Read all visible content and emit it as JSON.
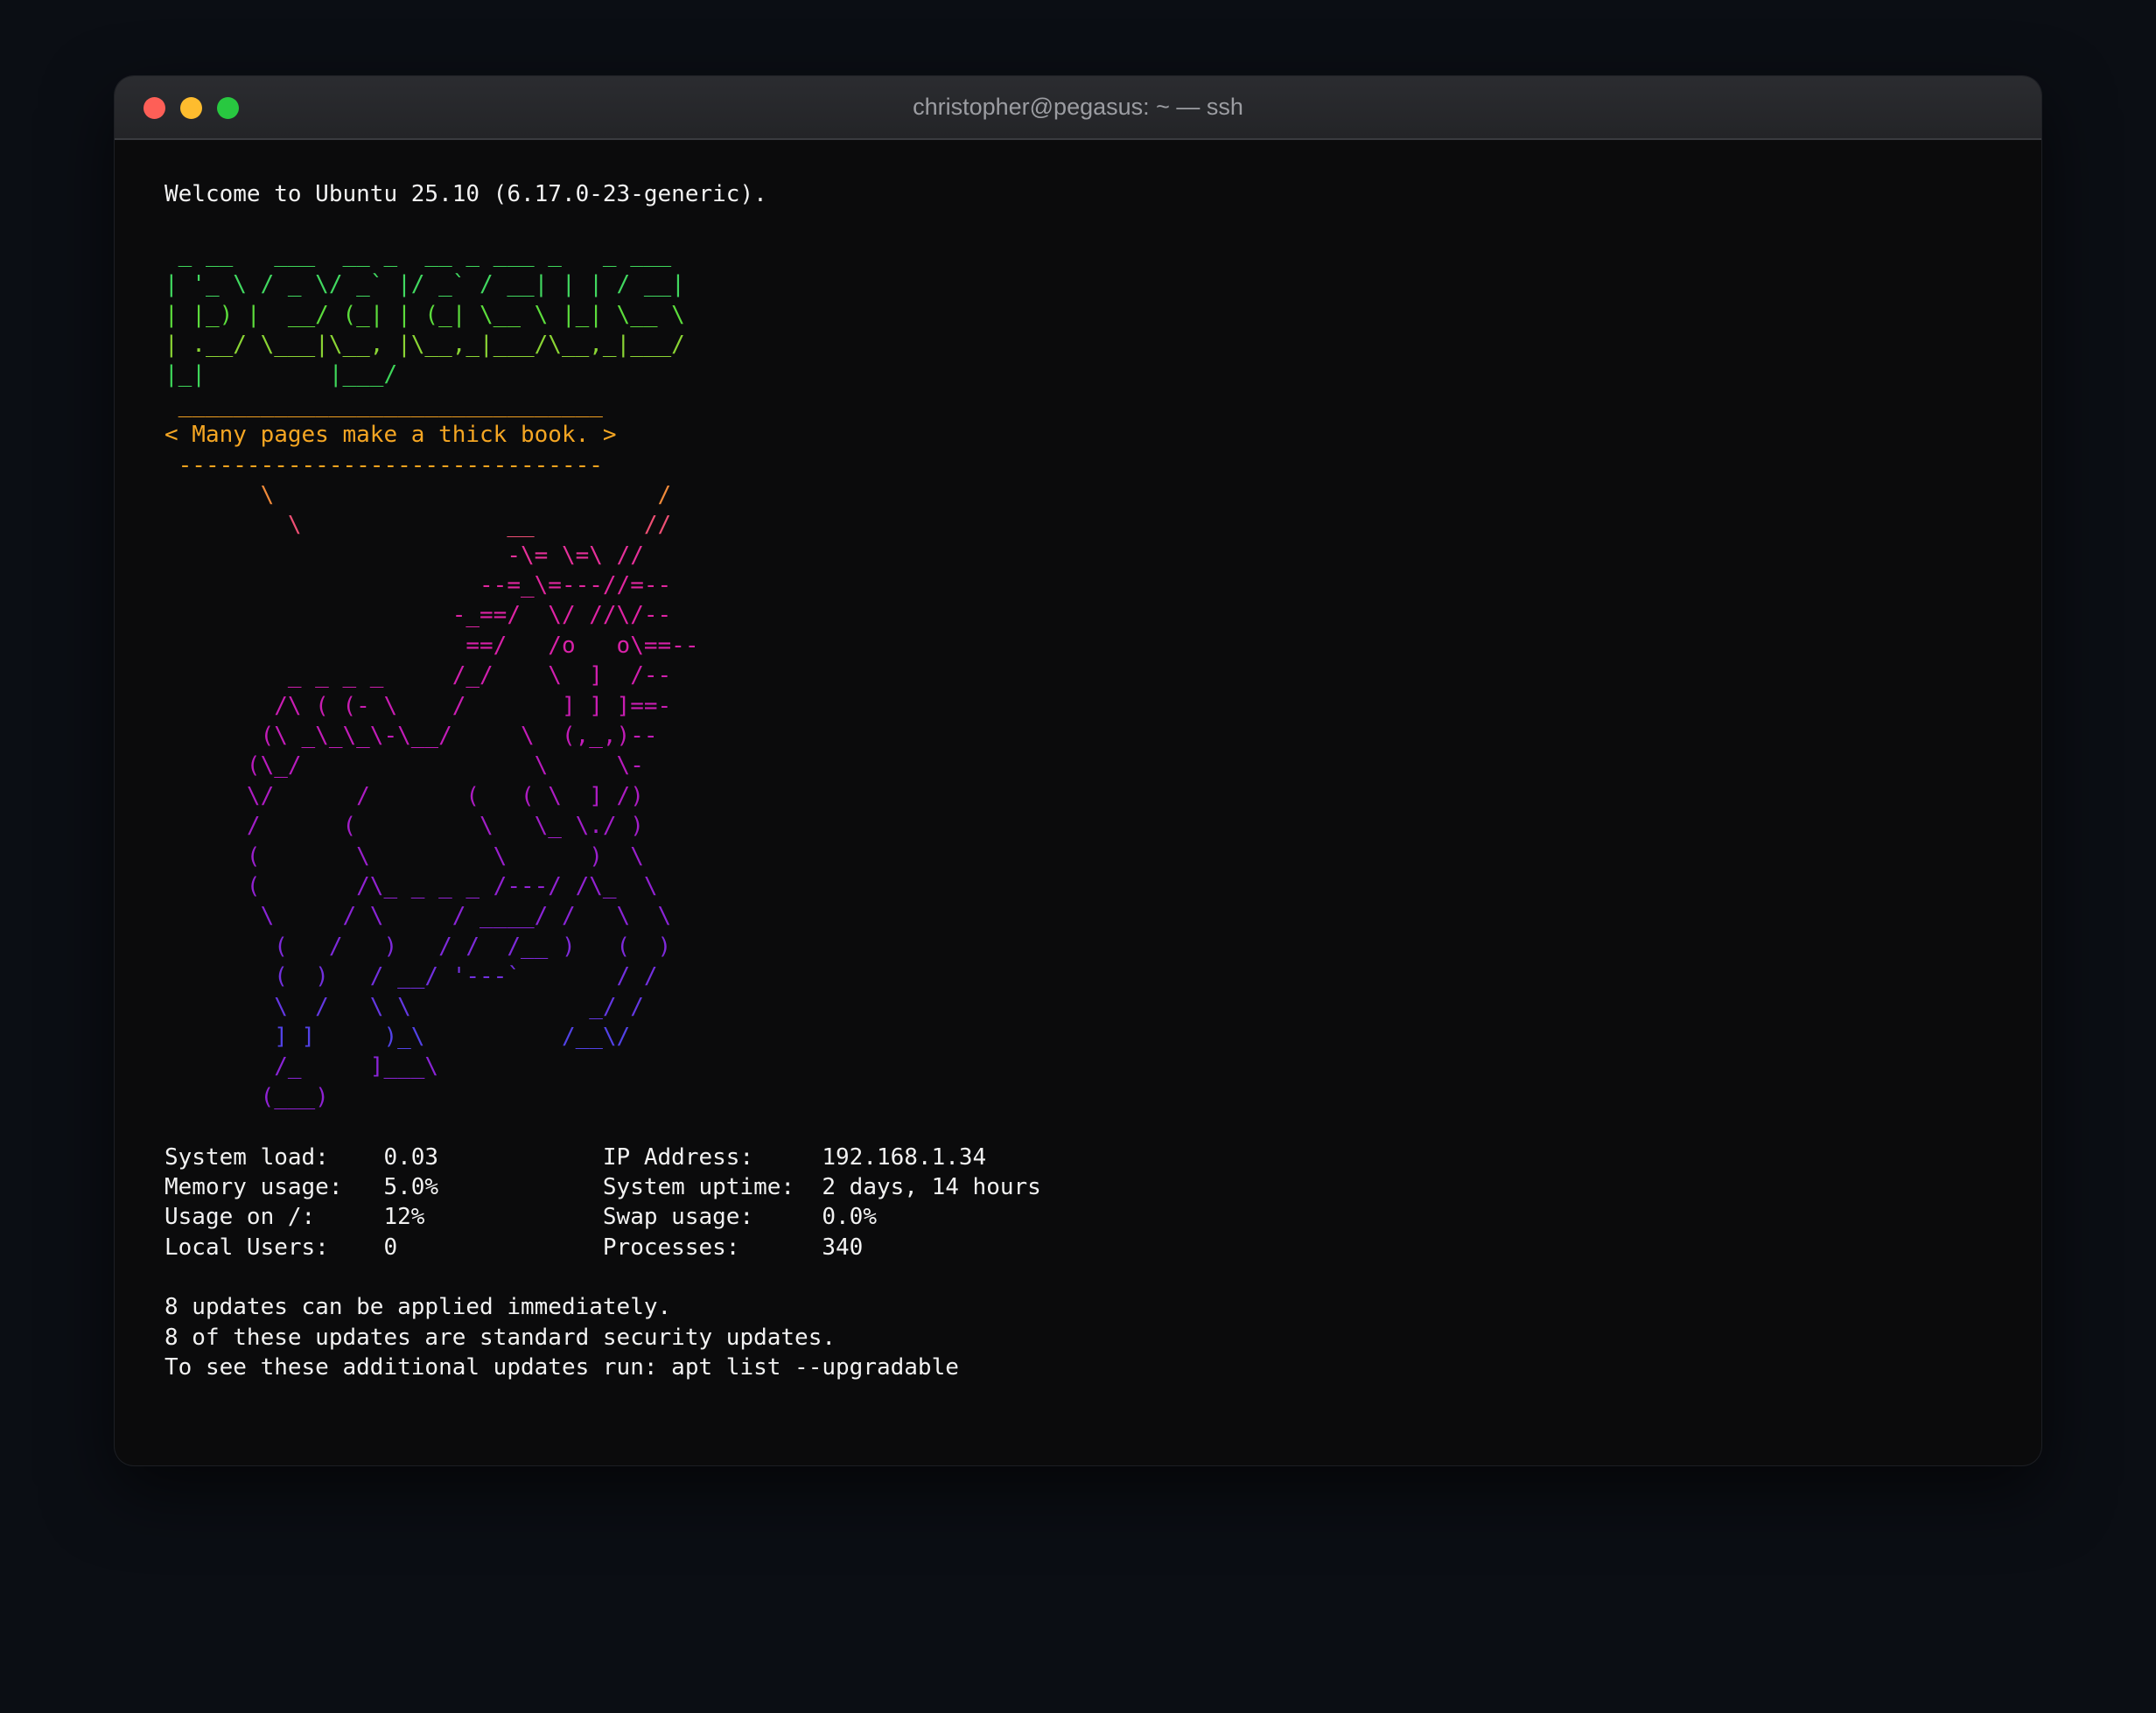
{
  "window": {
    "title": "christopher@pegasus: ~ — ssh",
    "controls": {
      "close_color": "#fe5f57",
      "minimize_color": "#febc2e",
      "zoom_color": "#28c840"
    }
  },
  "terminal": {
    "lines": [
      {
        "text": "Welcome to Ubuntu 25.10 (6.17.0-23-generic).",
        "color": "#f2f2f2"
      },
      {
        "text": "",
        "color": "#f2f2f2"
      },
      {
        "text": " _ __   ___  __ _  __ _ ___ _   _ ___",
        "color": "#3ed65a"
      },
      {
        "text": "| '_ \\ / _ \\/ _` |/ _` / __| | | / __|",
        "color": "#41d860"
      },
      {
        "text": "| |_) |  __/ (_| | (_| \\__ \\ |_| \\__ \\",
        "color": "#5cdc3c"
      },
      {
        "text": "| .__/ \\___|\\__, |\\__,_|___/\\__,_|___/",
        "color": "#8ad434"
      },
      {
        "text": "|_|         |___/",
        "color": "#3ed65a"
      },
      {
        "text": " _______________________________",
        "color": "#f0a020"
      },
      {
        "text": "< Many pages make a thick book. >",
        "color": "#f5a623"
      },
      {
        "text": " -------------------------------",
        "color": "#f2a21e"
      },
      {
        "text": "       \\                            /",
        "color": "#f08a3a"
      },
      {
        "text": "         \\               __        //",
        "color": "#ee4f74"
      },
      {
        "text": "                         -\\= \\=\\ //",
        "color": "#e6309a"
      },
      {
        "text": "                       --=_\\=---//=--",
        "color": "#e0269e"
      },
      {
        "text": "                     -_==/  \\/ //\\/--",
        "color": "#de23a4"
      },
      {
        "text": "                      ==/   /o   o\\==--",
        "color": "#d821a8"
      },
      {
        "text": "         _ _ _ _     /_/    \\  ]  /--",
        "color": "#d01fae"
      },
      {
        "text": "        /\\ ( (- \\    /       ] ] ]==-",
        "color": "#c91db2"
      },
      {
        "text": "       (\\ _\\_\\_\\-\\__/     \\  (,_,)--",
        "color": "#c21cb8"
      },
      {
        "text": "      (\\_/                 \\     \\-",
        "color": "#b81bbd"
      },
      {
        "text": "      \\/      /       (   ( \\  ] /)",
        "color": "#ad1cc2"
      },
      {
        "text": "      /      (         \\   \\_ \\./ )",
        "color": "#a21ec8"
      },
      {
        "text": "      (       \\         \\      )  \\",
        "color": "#9a20cc"
      },
      {
        "text": "      (       /\\_ _ _ _ /---/ /\\_  \\",
        "color": "#9222d2"
      },
      {
        "text": "       \\     / \\     / ____/ /   \\  \\",
        "color": "#8a24d6"
      },
      {
        "text": "        (   /   )   / /  /__ )   (  )",
        "color": "#7e2ada"
      },
      {
        "text": "        (  )   / __/ '---`       / /",
        "color": "#7230de"
      },
      {
        "text": "        \\  /   \\ \\             _/ /",
        "color": "#6438e2"
      },
      {
        "text": "        ] ]     )_\\          /__\\/",
        "color": "#5242e6"
      },
      {
        "text": "        /_     ]___\\",
        "color": "#8a24d6"
      },
      {
        "text": "       (___)",
        "color": "#8f22d4"
      },
      {
        "text": "",
        "color": "#f2f2f2"
      },
      {
        "text": "System load:    0.03            IP Address:     192.168.1.34",
        "color": "#f2f2f2"
      },
      {
        "text": "Memory usage:   5.0%            System uptime:  2 days, 14 hours",
        "color": "#f2f2f2"
      },
      {
        "text": "Usage on /:     12%             Swap usage:     0.0%",
        "color": "#f2f2f2"
      },
      {
        "text": "Local Users:    0               Processes:      340",
        "color": "#f2f2f2"
      },
      {
        "text": "",
        "color": "#f2f2f2"
      },
      {
        "text": "8 updates can be applied immediately.",
        "color": "#f2f2f2"
      },
      {
        "text": "8 of these updates are standard security updates.",
        "color": "#f2f2f2"
      },
      {
        "text": "To see these additional updates run: apt list --upgradable",
        "color": "#f2f2f2"
      }
    ]
  }
}
